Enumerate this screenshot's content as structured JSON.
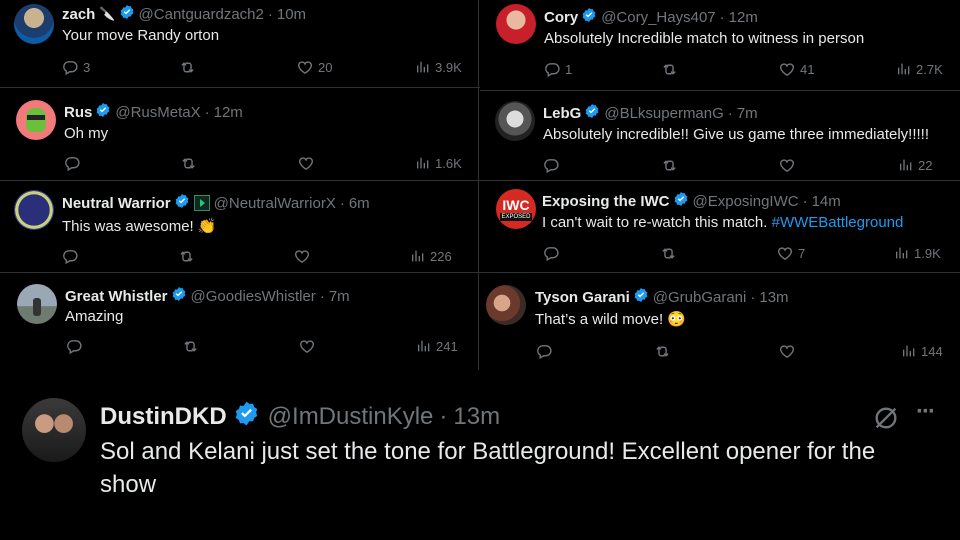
{
  "tweets": [
    {
      "name": "zach",
      "emoji": "🔪",
      "handle": "@Cantguardzach2",
      "time": "10m",
      "text": "Your move Randy orton",
      "replies": "3",
      "likes": "20",
      "views": "3.9K"
    },
    {
      "name": "Rus",
      "handle": "@RusMetaX",
      "time": "12m",
      "text": "Oh my",
      "replies": "",
      "likes": "",
      "views": "1.6K"
    },
    {
      "name": "Neutral Warrior",
      "handle": "@NeutralWarriorX",
      "time": "6m",
      "text": "This was awesome! 👏",
      "replies": "",
      "likes": "",
      "views": "226"
    },
    {
      "name": "Great Whistler",
      "handle": "@GoodiesWhistler",
      "time": "7m",
      "text": "Amazing",
      "replies": "",
      "likes": "",
      "views": "241"
    },
    {
      "name": "Cory",
      "handle": "@Cory_Hays407",
      "time": "12m",
      "text": "Absolutely Incredible match to witness in person",
      "replies": "1",
      "likes": "41",
      "views": "2.7K"
    },
    {
      "name": "LebG",
      "handle": "@BLksupermanG",
      "time": "7m",
      "text": "Absolutely incredible!! Give us game three immediately!!!!!",
      "replies": "",
      "likes": "",
      "views": "22"
    },
    {
      "name": "Exposing the IWC",
      "handle": "@ExposingIWC",
      "time": "14m",
      "text_before": "I can't wait to re-watch this match. ",
      "hashtag": "#WWEBattleground",
      "replies": "",
      "likes": "7",
      "views": "1.9K",
      "avatar_text": "IWC",
      "avatar_sub": "EXPOSED"
    },
    {
      "name": "Tyson Garani",
      "handle": "@GrubGarani",
      "time": "13m",
      "text": "That’s a wild move! 😳",
      "replies": "",
      "likes": "",
      "views": "144"
    }
  ],
  "main_tweet": {
    "name": "DustinDKD",
    "handle": "@ImDustinKyle",
    "time": "13m",
    "text_line1": "Sol and Kelani just set the tone for Battleground! Excellent opener for the",
    "text_line2": "show",
    "more_label": "···"
  },
  "colors": {
    "background": "#000000",
    "text": "#e7e9ea",
    "muted": "#71767b",
    "verified": "#1d9bf0",
    "divider": "#2f3336"
  }
}
